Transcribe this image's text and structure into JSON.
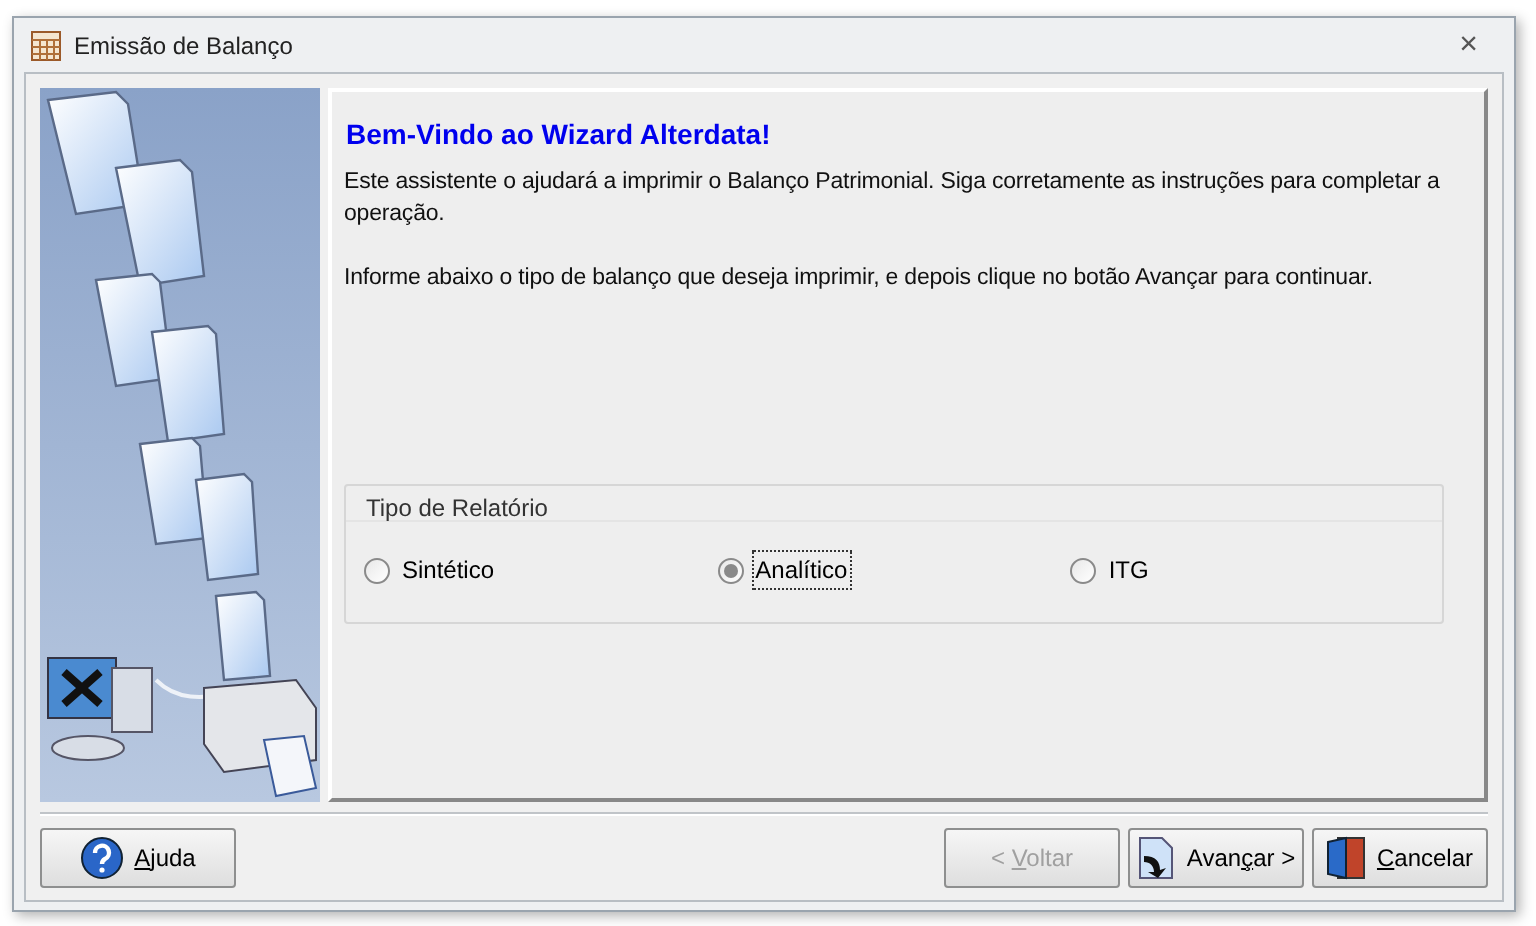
{
  "window": {
    "title": "Emissão de Balanço",
    "close": "×"
  },
  "heading": "Bem-Vindo ao Wizard Alterdata!",
  "paragraphs": [
    "Este assistente o ajudará a imprimir o Balanço Patrimonial. Siga corretamente as instruções para completar a operação.",
    "Informe abaixo o tipo de balanço que deseja imprimir, e depois clique no botão Avançar para continuar."
  ],
  "report_type": {
    "title": "Tipo de Relatório",
    "options": [
      {
        "label": "Sintético",
        "selected": false,
        "focused": false
      },
      {
        "label": "Analítico",
        "selected": true,
        "focused": true
      },
      {
        "label": "ITG",
        "selected": false,
        "focused": false
      }
    ]
  },
  "buttons": [
    {
      "kind": "help",
      "mnemonic": "A",
      "label_after": "juda",
      "disabled": false
    },
    {
      "kind": "back",
      "label_before": "< ",
      "mnemonic": "V",
      "label_after": "oltar",
      "disabled": true
    },
    {
      "kind": "next",
      "label_before": "Avan",
      "mnemonic": "ç",
      "label_after": "ar >",
      "disabled": false
    },
    {
      "kind": "cancel",
      "mnemonic": "C",
      "label_after": "ancelar",
      "disabled": false
    }
  ]
}
